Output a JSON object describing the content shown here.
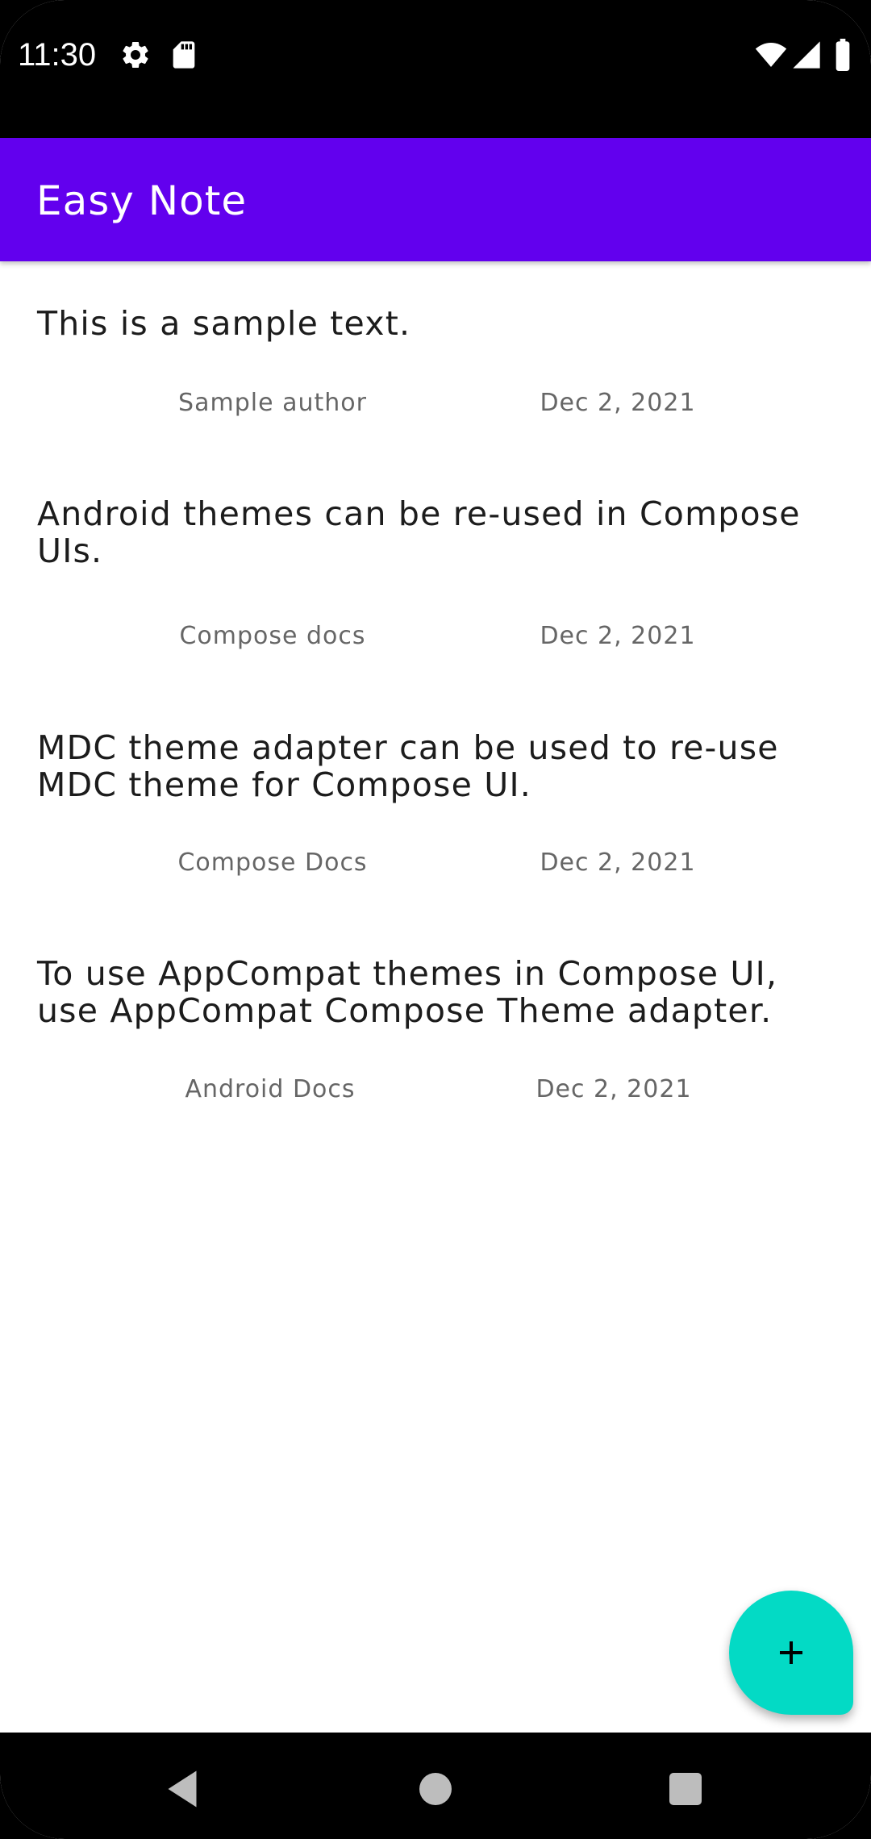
{
  "status_bar": {
    "time": "11:30",
    "icons_left": [
      "gear-icon",
      "sd-card-icon"
    ],
    "icons_right": [
      "wifi-icon",
      "signal-icon",
      "battery-icon"
    ]
  },
  "app_bar": {
    "title": "Easy Note",
    "color": "#6200ee"
  },
  "notes": [
    {
      "text": "This is a sample text.",
      "author": "Sample author",
      "date": "Dec 2, 2021"
    },
    {
      "text": "Android themes can be re-used in Compose UIs.",
      "author": "Compose docs",
      "date": "Dec 2, 2021"
    },
    {
      "text": "MDC theme adapter can be used to re-use MDC theme for Compose UI.",
      "author": "Compose Docs",
      "date": "Dec 2, 2021"
    },
    {
      "text": "To use AppCompat themes in Compose UI, use AppCompat Compose Theme adapter.",
      "author": "Android Docs",
      "date": "Dec 2, 2021"
    }
  ],
  "fab": {
    "icon": "plus-icon",
    "color": "#03dac5"
  },
  "nav_bar": {
    "buttons": [
      "back-icon",
      "home-icon",
      "recents-icon"
    ]
  }
}
